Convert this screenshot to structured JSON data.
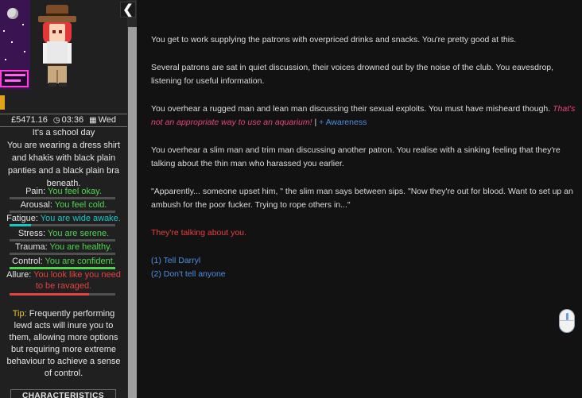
{
  "sidebar": {
    "collapse_icon": "chevron-left-icon",
    "collapse_glyph": "❮",
    "money": "£5471.16",
    "time": "03:36",
    "day": "Wed",
    "clock_icon": "clock-icon",
    "calendar_icon": "calendar-icon",
    "school_day": "It's a school day",
    "outfit": "You are wearing a dress shirt and khakis with black plain panties and a black plain bra beneath.",
    "stats": [
      {
        "label": "Pain:",
        "value": "You feel okay.",
        "color": "#4fd64f",
        "level": 0.0,
        "bar_color": "#4fd64f"
      },
      {
        "label": "Arousal:",
        "value": "You feel cold.",
        "color": "#4fd64f",
        "level": 0.0,
        "bar_color": "#4fd64f"
      },
      {
        "label": "Fatigue:",
        "value": "You are wide awake.",
        "color": "#19c6c6",
        "level": 0.2,
        "bar_color": "#19c6c6"
      },
      {
        "label": "Stress:",
        "value": "You are serene.",
        "color": "#4fd64f",
        "level": 0.0,
        "bar_color": "#4fd64f"
      },
      {
        "label": "Trauma:",
        "value": "You are healthy.",
        "color": "#4fd64f",
        "level": 0.0,
        "bar_color": "#4fd64f"
      },
      {
        "label": "Control:",
        "value": "You are confident.",
        "color": "#4fd64f",
        "level": 1.0,
        "bar_color": "#4fd64f"
      },
      {
        "label": "Allure:",
        "value": "You look like you need to be ravaged.",
        "color": "#e84040",
        "level": 0.75,
        "bar_color": "#e84040"
      }
    ],
    "tip_label": "Tip:",
    "tip_text": "Frequently performing lewd acts will inure you to them, allowing more options but requiring more extreme behaviour to achieve a sense of control.",
    "characteristics_button": "CHARACTERISTICS"
  },
  "main": {
    "p1": "You get to work supplying the patrons with overpriced drinks and snacks. You're pretty good at this.",
    "p2": "Several patrons are sat in quiet discussion, their voices drowned out by the noise of the club. You eavesdrop, listening for useful information.",
    "p3_text": "You overhear a rugged man and lean man discussing their sexual exploits. You must have misheard though. ",
    "p3_italic": "That's not an appropriate way to use an aquarium!",
    "p3_sep": " | ",
    "p3_awareness": "+ Awareness",
    "p4": "You overhear a slim man and trim man discussing another patron. You realise with a sinking feeling that they're talking about the thin man who harassed you earlier.",
    "p5": "\"Apparently... someone upset him, \" the slim man says between sips. \"Now they're out for blood. Want to set up an ambush for the poor fucker. Trying to rope others in...\"",
    "p6": "They're talking about you.",
    "choices": [
      "(1) Tell Darryl",
      "(2) Don't tell anyone"
    ],
    "mouse_icon": "mouse-icon"
  },
  "colors": {
    "background": "#121212",
    "sidebar": "#202020",
    "link": "#4b8fe6",
    "danger": "#e84040",
    "good": "#4fd64f",
    "tip": "#e5c32a",
    "thought": "#e8457a"
  }
}
